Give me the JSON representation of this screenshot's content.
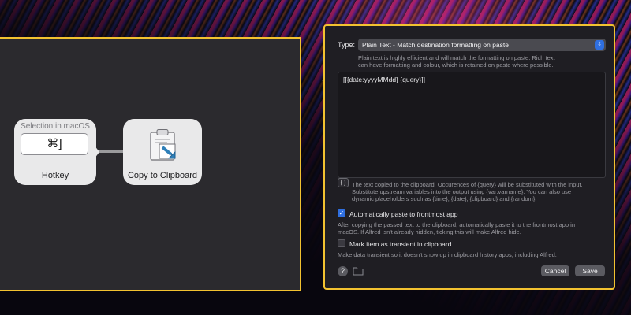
{
  "workflow": {
    "hotkey_node": {
      "subtitle": "Selection in macOS",
      "keys": "⌘]",
      "title": "Hotkey"
    },
    "copy_node": {
      "title": "Copy to Clipboard",
      "icon": "clipboard-icon"
    }
  },
  "config": {
    "type_label": "Type:",
    "type_value": "Plain Text - Match destination formatting on paste",
    "type_help_line1": "Plain text is highly efficient and will match the formatting on paste. Rich text",
    "type_help_line2": "can have formatting and colour, which is retained on paste where possible.",
    "text_value": "[[{date:yyyyMMdd} {query}]]",
    "brace_button": "{ }",
    "text_help_line1": "The text copied to the clipboard. Occurences of {query} will be substituted with the input.",
    "text_help_line2": "Substitute upstream variables into the output using {var:varname}. You can also use",
    "text_help_line3": "dynamic placeholders such as {time}, {date}, {clipboard} and {random}.",
    "auto_paste_label": "Automatically paste to frontmost app",
    "auto_paste_checked": true,
    "auto_paste_help_line1": "After copying the passed text to the clipboard, automatically paste it to the frontmost app in",
    "auto_paste_help_line2": "macOS. If Alfred isn't already hidden, ticking this will make Alfred hide.",
    "transient_label": "Mark item as transient in clipboard",
    "transient_checked": false,
    "transient_help": "Make data transient so it doesn't show up in clipboard history apps, including Alfred.",
    "help_button": "?",
    "cancel_label": "Cancel",
    "save_label": "Save"
  },
  "colors": {
    "highlight_border": "#f2c230",
    "accent": "#2f6fe0"
  }
}
